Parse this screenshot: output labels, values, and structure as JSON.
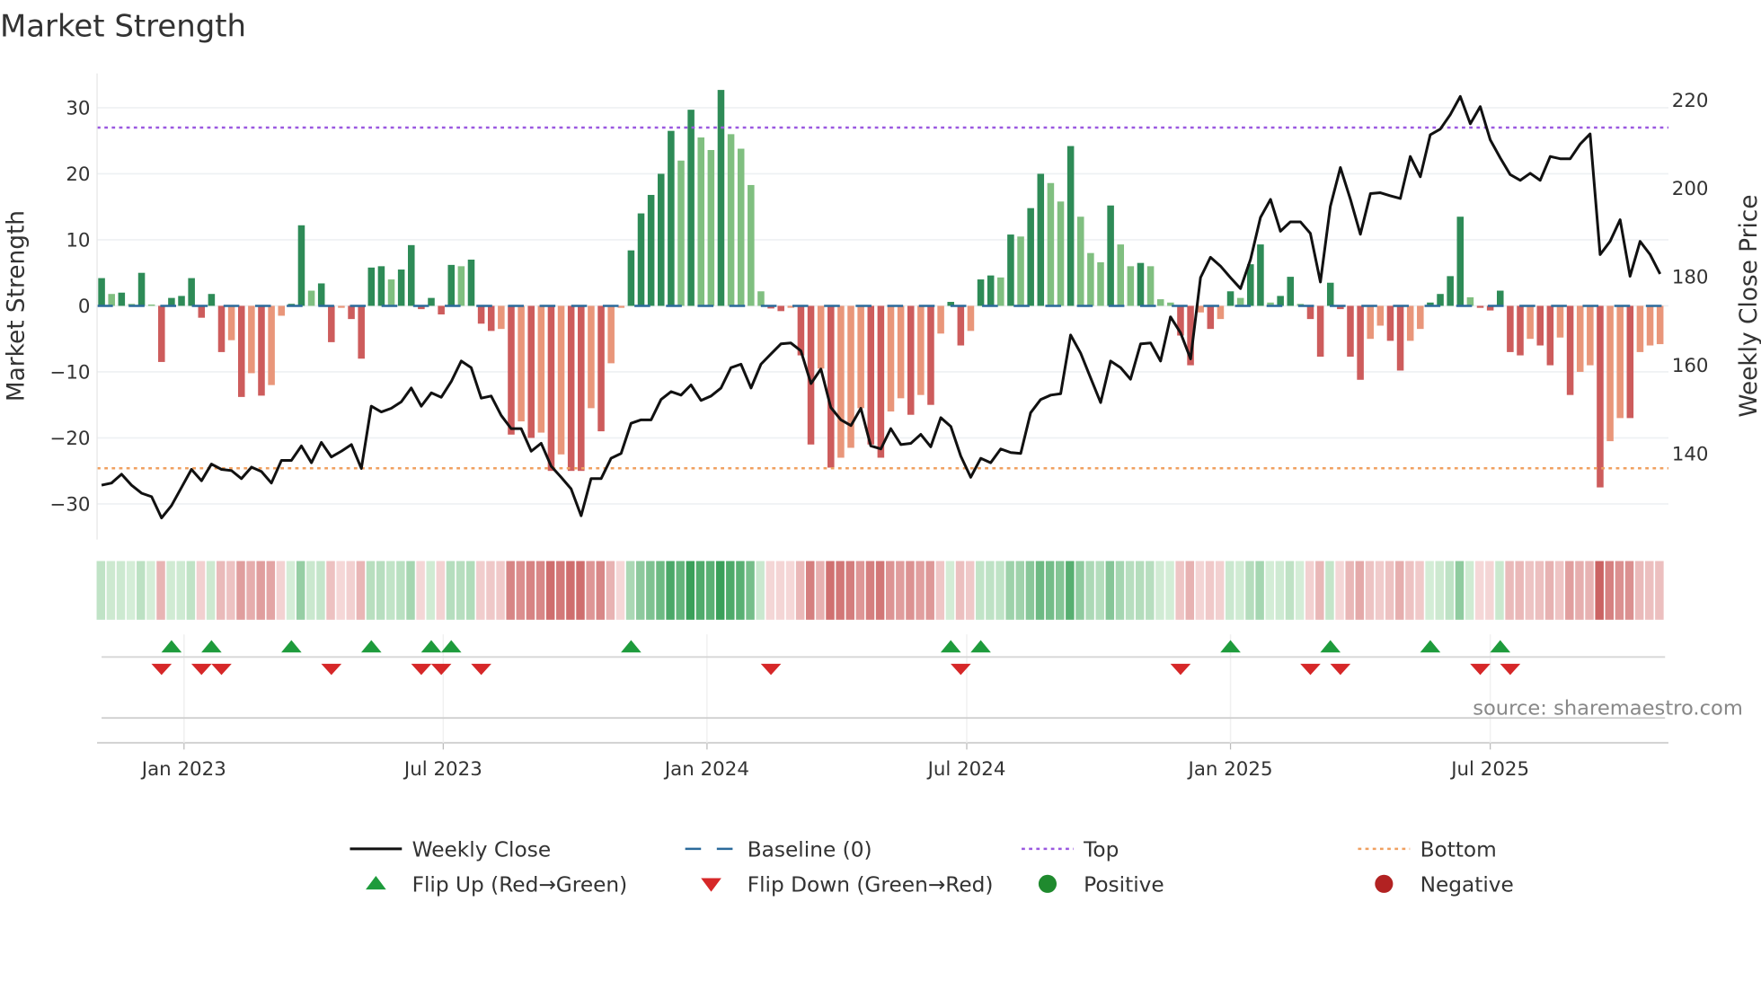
{
  "title": "Market Strength",
  "source": "source: sharemaestro.com",
  "chart_data": {
    "type": "bar",
    "title": "Market Strength",
    "ylabel": "Market Strength",
    "y2label": "Weekly Close Price",
    "ylim": [
      -35.4,
      35.2
    ],
    "y2lim": [
      120.5,
      226
    ],
    "yticks": [
      30,
      20,
      10,
      0,
      -10,
      -20,
      -30
    ],
    "yticklabels": [
      "30",
      "20",
      "10",
      "0",
      "−10",
      "−20",
      "−30"
    ],
    "y2ticks": [
      220,
      200,
      180,
      160,
      140
    ],
    "y2ticklabels": [
      "220",
      "200",
      "180",
      "160",
      "140"
    ],
    "grid": true,
    "top_level": 27,
    "bottom_level": -24.6,
    "x_unit": "week index",
    "xticks": [
      {
        "week": 8.25,
        "label": "Jan 2023"
      },
      {
        "week": 34.2,
        "label": "Jul 2023"
      },
      {
        "week": 60.6,
        "label": "Jan 2024"
      },
      {
        "week": 86.6,
        "label": "Jul 2024"
      },
      {
        "week": 113.0,
        "label": "Jan 2025"
      },
      {
        "week": 139.0,
        "label": "Jul 2025"
      }
    ],
    "strength": [
      4.2,
      1.8,
      2,
      0.3,
      5,
      0.2,
      -8.5,
      1.2,
      1.5,
      4.2,
      -1.8,
      1.8,
      -7,
      -5.2,
      -13.8,
      -10.2,
      -13.6,
      -12,
      -1.5,
      0.3,
      12.2,
      2.3,
      3.4,
      -5.5,
      -0.3,
      -2,
      -8,
      5.8,
      6,
      4,
      5.5,
      9.2,
      -0.5,
      1.2,
      -1.3,
      6.2,
      6,
      7,
      -2.7,
      -3.8,
      -3.5,
      -19.5,
      -17.5,
      -20,
      -19.2,
      -25,
      -22.5,
      -25,
      -25,
      -15.5,
      -19,
      -8.7,
      -0.3,
      8.4,
      14,
      16.8,
      20,
      26.5,
      22,
      29.7,
      25.5,
      23.6,
      32.7,
      26,
      23.8,
      18.3,
      2.2,
      -0.4,
      -0.8,
      -0.3,
      -7.5,
      -21,
      -9.5,
      -24.5,
      -23,
      -21.5,
      -15.5,
      -21,
      -23,
      -16,
      -14,
      -16.5,
      -13.5,
      -15,
      -4.2,
      0.6,
      -6,
      -3.8,
      4,
      4.6,
      4.3,
      10.8,
      10.5,
      14.8,
      20,
      18.6,
      15.8,
      24.2,
      13.5,
      8,
      6.6,
      15.2,
      9.3,
      6,
      6.5,
      6,
      1,
      0.5,
      -4.5,
      -9,
      -1,
      -3.5,
      -2,
      2.2,
      1.2,
      6.3,
      9.3,
      0.5,
      1.5,
      4.4,
      0.3,
      -2,
      -7.7,
      3.5,
      -0.5,
      -7.7,
      -11.2,
      -5,
      -3,
      -5.3,
      -9.8,
      -5.3,
      -3.5,
      0.5,
      1.8,
      4.5,
      13.5,
      1.3,
      -0.3,
      -0.7,
      2.3,
      -7,
      -7.5,
      -5,
      -6,
      -9,
      -4.8,
      -13.5,
      -10,
      -9,
      -27.5,
      -20.5,
      -17,
      -17,
      -7,
      -6,
      -5.8
    ],
    "weekly_close": [
      132.8,
      133.3,
      135.3,
      132.8,
      131.0,
      130.2,
      125.4,
      128.2,
      132.3,
      136.4,
      133.8,
      137.6,
      136.4,
      136.1,
      134.3,
      136.9,
      135.9,
      133.3,
      138.4,
      138.4,
      141.7,
      137.9,
      142.5,
      139.2,
      140.5,
      142.0,
      136.6,
      150.7,
      149.4,
      150.2,
      151.7,
      154.8,
      150.7,
      153.7,
      152.7,
      156.3,
      160.9,
      159.4,
      152.5,
      153.0,
      148.6,
      145.6,
      145.6,
      140.5,
      142.3,
      137.1,
      134.6,
      132.0,
      125.9,
      134.3,
      134.3,
      138.9,
      140.0,
      146.8,
      147.6,
      147.6,
      152.2,
      154.0,
      153.2,
      155.5,
      152.0,
      153.0,
      154.8,
      159.4,
      160.2,
      154.8,
      160.2,
      162.5,
      164.8,
      165.0,
      163.2,
      155.8,
      159.1,
      150.4,
      147.6,
      146.3,
      150.2,
      141.7,
      141.0,
      145.6,
      142.0,
      142.3,
      144.3,
      141.5,
      148.1,
      146.1,
      139.4,
      134.6,
      138.9,
      137.9,
      141.0,
      140.2,
      140.0,
      149.2,
      152.2,
      153.2,
      153.5,
      166.8,
      162.7,
      157.1,
      151.5,
      160.9,
      159.4,
      156.8,
      164.8,
      165.0,
      160.9,
      170.9,
      167.3,
      161.4,
      179.8,
      184.4,
      182.4,
      179.8,
      177.3,
      183.9,
      193.4,
      197.5,
      190.3,
      192.4,
      192.4,
      189.8,
      178.8,
      195.9,
      204.7,
      197.5,
      189.6,
      198.8,
      199.0,
      198.3,
      197.7,
      207.2,
      202.6,
      212.1,
      213.4,
      216.7,
      220.8,
      214.6,
      218.5,
      211.0,
      206.9,
      203.1,
      201.8,
      203.4,
      201.8,
      207.2,
      206.7,
      206.7,
      210.0,
      212.3,
      185.0,
      188.0,
      192.9,
      180.1,
      188.0,
      185.0,
      180.6
    ],
    "flip_up_weeks": [
      7,
      11,
      19,
      27,
      33,
      35,
      53,
      85,
      88,
      113,
      123,
      133,
      140
    ],
    "flip_down_weeks": [
      6,
      10,
      12,
      23,
      32,
      34,
      38,
      67,
      86,
      108,
      121,
      124,
      138,
      141
    ],
    "legend": [
      {
        "label": "Weekly Close",
        "symbol": "line"
      },
      {
        "label": "Baseline (0)",
        "symbol": "dash"
      },
      {
        "label": "Top",
        "symbol": "dot-purple"
      },
      {
        "label": "Bottom",
        "symbol": "dot-orange"
      },
      {
        "label": "Flip Up (Red→Green)",
        "symbol": "tri-up"
      },
      {
        "label": "Flip Down (Green→Red)",
        "symbol": "tri-down"
      },
      {
        "label": "Positive",
        "symbol": "circle-green"
      },
      {
        "label": "Negative",
        "symbol": "circle-red"
      }
    ],
    "legend_position": "bottom-center"
  },
  "colors": {
    "green_rising": "#2e8b57",
    "green_falling": "#80bf80",
    "red_falling": "#cd5c5c",
    "red_rising": "#e9967a",
    "price": "#111111",
    "baseline": "#2b6a9b",
    "top": "#9b59e0",
    "bottom": "#f0a060",
    "flip_up": "#1e9b3c",
    "flip_down": "#d62728",
    "positive": "#1f8a2e",
    "negative": "#b22222"
  }
}
